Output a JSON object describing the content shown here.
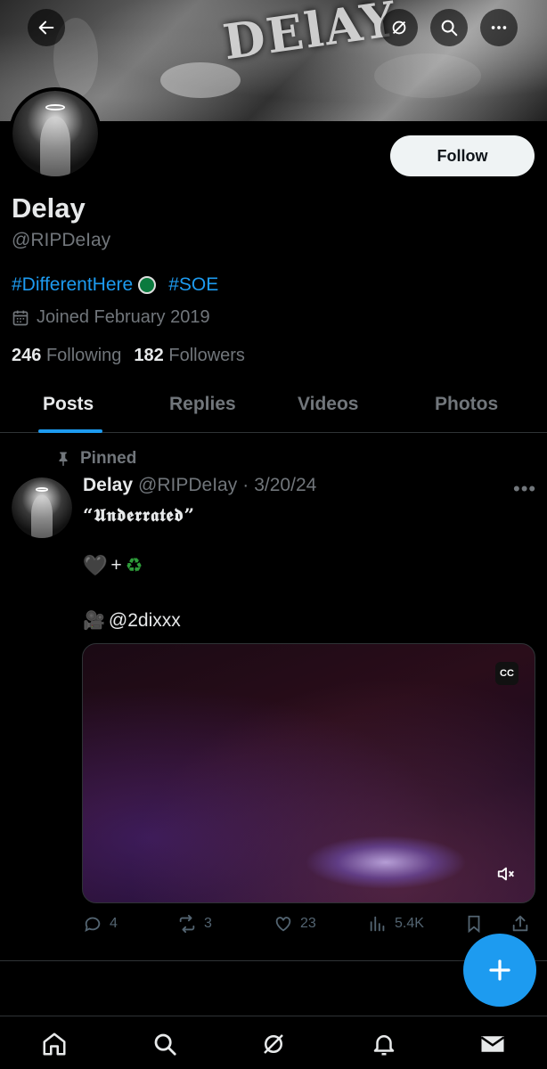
{
  "header": {
    "banner_text": "DElAY",
    "back_icon": "arrow-left-icon",
    "grok_icon": "grok-icon",
    "search_icon": "search-icon",
    "more_icon": "more-icon"
  },
  "profile": {
    "name": "Delay",
    "handle": "@RIPDeIay",
    "bio_tag1": "#DifferentHere",
    "bio_tag2": "#SOE",
    "joined": "Joined February 2019",
    "following_count": "246",
    "following_label": "Following",
    "followers_count": "182",
    "followers_label": "Followers",
    "follow_button": "Follow"
  },
  "tabs": [
    {
      "label": "Posts",
      "active": true
    },
    {
      "label": "Replies",
      "active": false
    },
    {
      "label": "Videos",
      "active": false
    },
    {
      "label": "Photos",
      "active": false
    }
  ],
  "post": {
    "pinned_label": "Pinned",
    "author_name": "Delay",
    "author_handle": "@RIPDeIay",
    "separator": "·",
    "date": "3/20/24",
    "text_line1": "“𝖀𝖓𝖉𝖊𝖗𝖗𝖆𝖙𝖊𝖉”",
    "text_line2_plus": "+",
    "text_line3": "@2dixxx",
    "cc_label": "CC",
    "replies": "4",
    "reposts": "3",
    "likes": "23",
    "views": "5.4K"
  },
  "colors": {
    "accent": "#1d9bf0",
    "background": "#000000",
    "muted": "#71767b"
  }
}
